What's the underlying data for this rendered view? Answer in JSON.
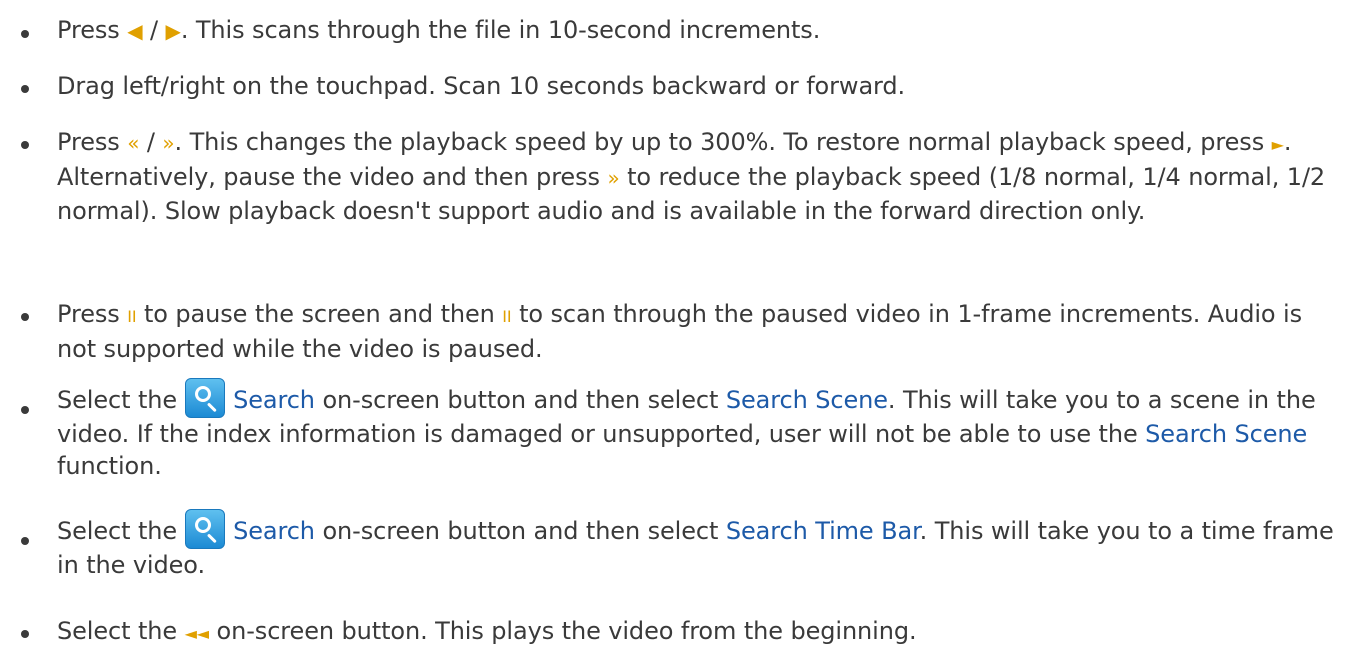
{
  "icons": {
    "prev": "◀",
    "next": "▶",
    "rewind": "«",
    "fast_forward": "»",
    "play": "►",
    "pause": "II",
    "skip_to_start": "◄◄",
    "search": "search-icon"
  },
  "colors": {
    "text": "#3a3a3a",
    "keyword": "#1d5aa8",
    "remote_symbol": "#e0a000",
    "search_button": "#2a9be0"
  },
  "items": [
    {
      "a": "Press ",
      "b": " / ",
      "c": ". This scans through the file in 10-second increments."
    },
    {
      "a": "Drag left/right on the touchpad. Scan 10 seconds backward or forward."
    },
    {
      "a": "Press ",
      "b": " / ",
      "c": ". This changes the playback speed by up to 300%. To restore normal playback speed, press ",
      "d": ". Alternatively, pause the video and then press ",
      "e": " to reduce the playback speed (1/8 normal, 1/4 normal, 1/2 normal). Slow playback doesn't support audio and is available in the forward direction only."
    },
    {
      "a": "Press ",
      "b": " to pause the screen and then ",
      "c": " to scan through the paused video in 1-frame increments. Audio is not supported while the video is paused."
    },
    {
      "a": "Select the",
      "kw1": "Search",
      "b": " on-screen button and then select ",
      "kw2": "Search Scene",
      "c": ". This will take you to a scene in the video. If the index information is damaged or unsupported, user will not be able to use the ",
      "kw3": "Search Scene",
      "d": " function."
    },
    {
      "a": "Select the",
      "kw1": "Search",
      "b": " on-screen button and then select ",
      "kw2": "Search Time Bar",
      "c": ". This will take you to a time frame in the video."
    },
    {
      "a": "Select the ",
      "b": " on-screen button. This plays the video from the beginning."
    }
  ]
}
